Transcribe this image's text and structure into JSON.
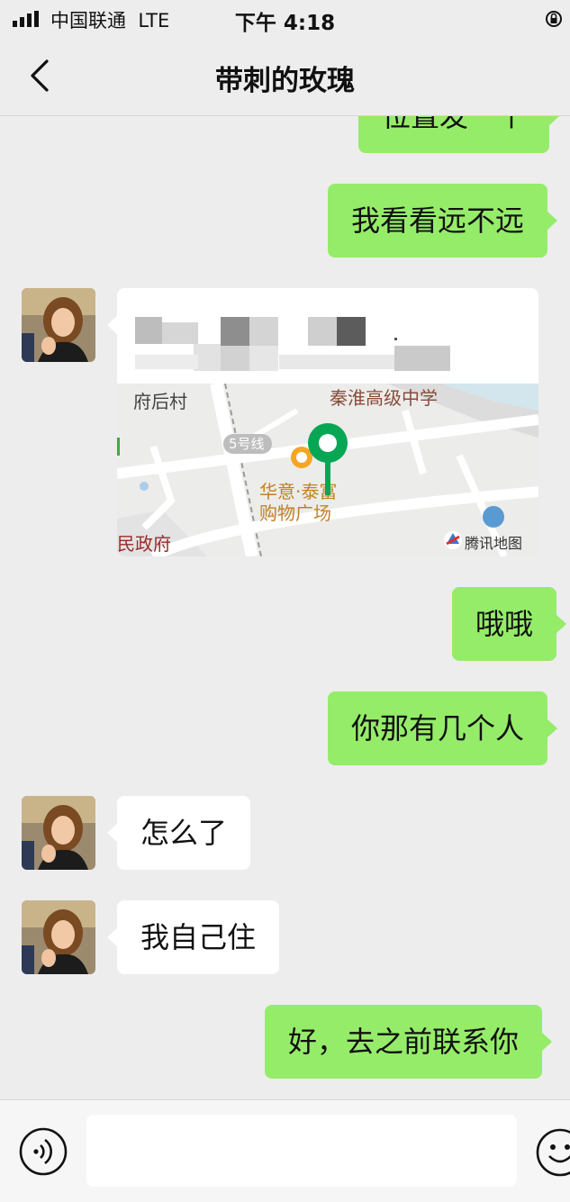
{
  "status_bar": {
    "carrier": "中国联通",
    "network": "LTE",
    "time": "下午 4:18"
  },
  "header": {
    "title": "带刺的玫瑰"
  },
  "messages": [
    {
      "side": "sent",
      "text": "位置发一个"
    },
    {
      "side": "sent",
      "text": "我看看远不远"
    },
    {
      "side": "recv",
      "type": "location"
    },
    {
      "side": "sent",
      "text": "哦哦"
    },
    {
      "side": "sent",
      "text": "你那有几个人"
    },
    {
      "side": "recv",
      "text": "怎么了"
    },
    {
      "side": "recv",
      "text": "我自己住"
    },
    {
      "side": "sent",
      "text": "好，去之前联系你"
    }
  ],
  "location_card": {
    "map_labels": {
      "village": "府后村",
      "school": "秦淮高级中学",
      "metro": "5号线",
      "mall_line1": "华意·泰富",
      "mall_line2": "购物广场",
      "gov": "民政府",
      "brand": "腾讯地图"
    }
  },
  "icons": {
    "back": "chevron-left-icon",
    "voice": "voice-icon",
    "emoji": "emoji-icon"
  },
  "colors": {
    "background": "#ededed",
    "sent_bubble": "#95ec69",
    "recv_bubble": "#ffffff",
    "pin": "#07a654"
  }
}
